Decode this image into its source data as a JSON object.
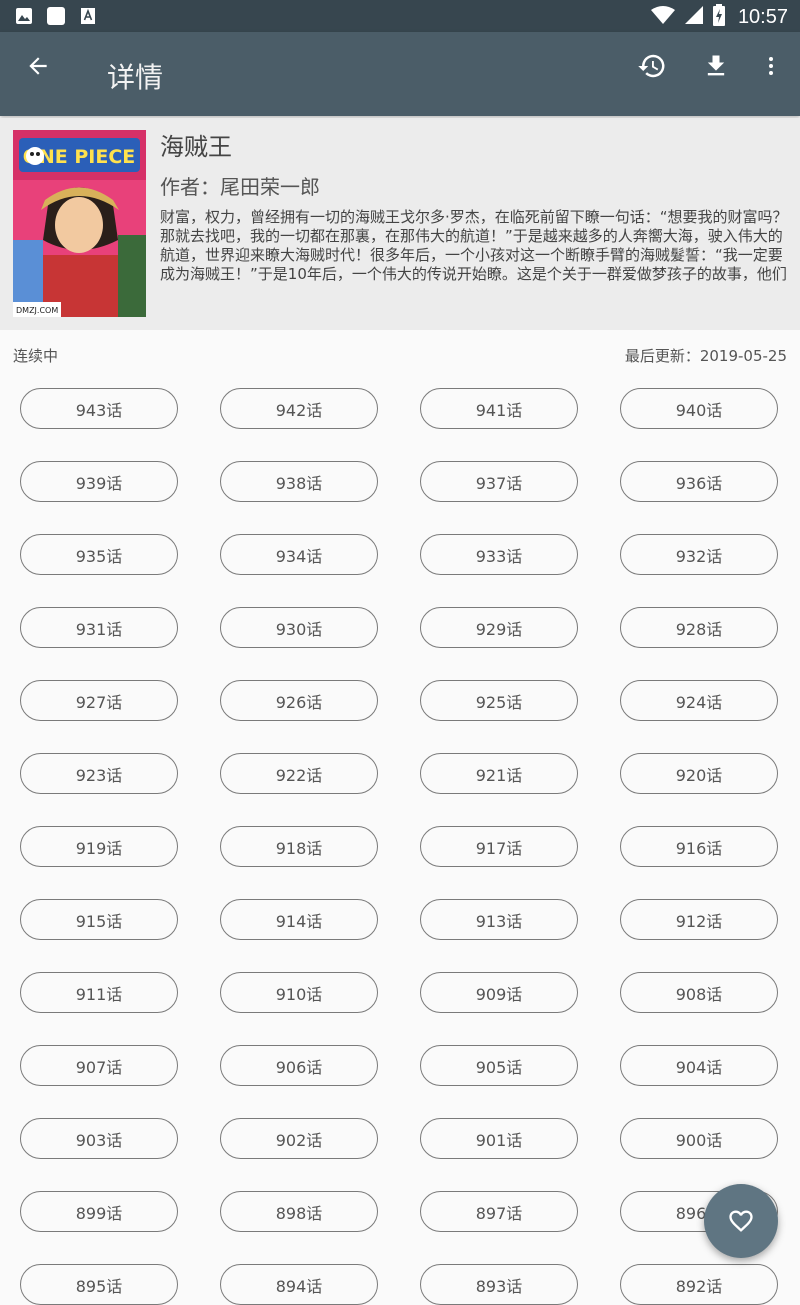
{
  "status_bar": {
    "time": "10:57",
    "icons": [
      "image-icon",
      "sim-card-icon",
      "text-icon",
      "wifi-icon",
      "signal-icon",
      "battery-icon"
    ]
  },
  "app_bar": {
    "title": "详情",
    "actions": [
      "history-icon",
      "download-icon",
      "more-vert-icon"
    ]
  },
  "comic": {
    "title": "海贼王",
    "author": "作者：尾田荣一郎",
    "description": "财富，权力，曾经拥有一切的海贼王戈尔多·罗杰，在临死前留下瞭一句话：“想要我的财富吗？那就去找吧，我的一切都在那裏，在那伟大的航道！”于是越来越多的人奔嚮大海，驶入伟大的航道，世界迎来瞭大海贼时代！很多年后，一个小孩对这一个断瞭手臂的海贼髮誓：“我一定要成为海贼王！”于是10年后，一个伟大的传说开始瞭。这是个关于一群爱做梦孩子的故事，他们拥有热情，他们拥有毅力，他们拥有伙伴……",
    "cover_text": "ONE PIECE",
    "cover_watermark": "DMZJ.COM"
  },
  "meta": {
    "status": "连续中",
    "last_update": "最后更新：2019-05-25"
  },
  "chapters": [
    "943话",
    "942话",
    "941话",
    "940话",
    "939话",
    "938话",
    "937话",
    "936话",
    "935话",
    "934话",
    "933话",
    "932话",
    "931话",
    "930话",
    "929话",
    "928话",
    "927话",
    "926话",
    "925话",
    "924话",
    "923话",
    "922话",
    "921话",
    "920话",
    "919话",
    "918话",
    "917话",
    "916话",
    "915话",
    "914话",
    "913话",
    "912话",
    "911话",
    "910话",
    "909话",
    "908话",
    "907话",
    "906话",
    "905话",
    "904话",
    "903话",
    "902话",
    "901话",
    "900话",
    "899话",
    "898话",
    "897话",
    "896话",
    "895话",
    "894话",
    "893话",
    "892话"
  ],
  "fab": {
    "icon": "heart-outline-icon"
  },
  "colors": {
    "app_bar": "#4b5d68",
    "status_bar": "#37464f",
    "fab": "#5f7582"
  }
}
